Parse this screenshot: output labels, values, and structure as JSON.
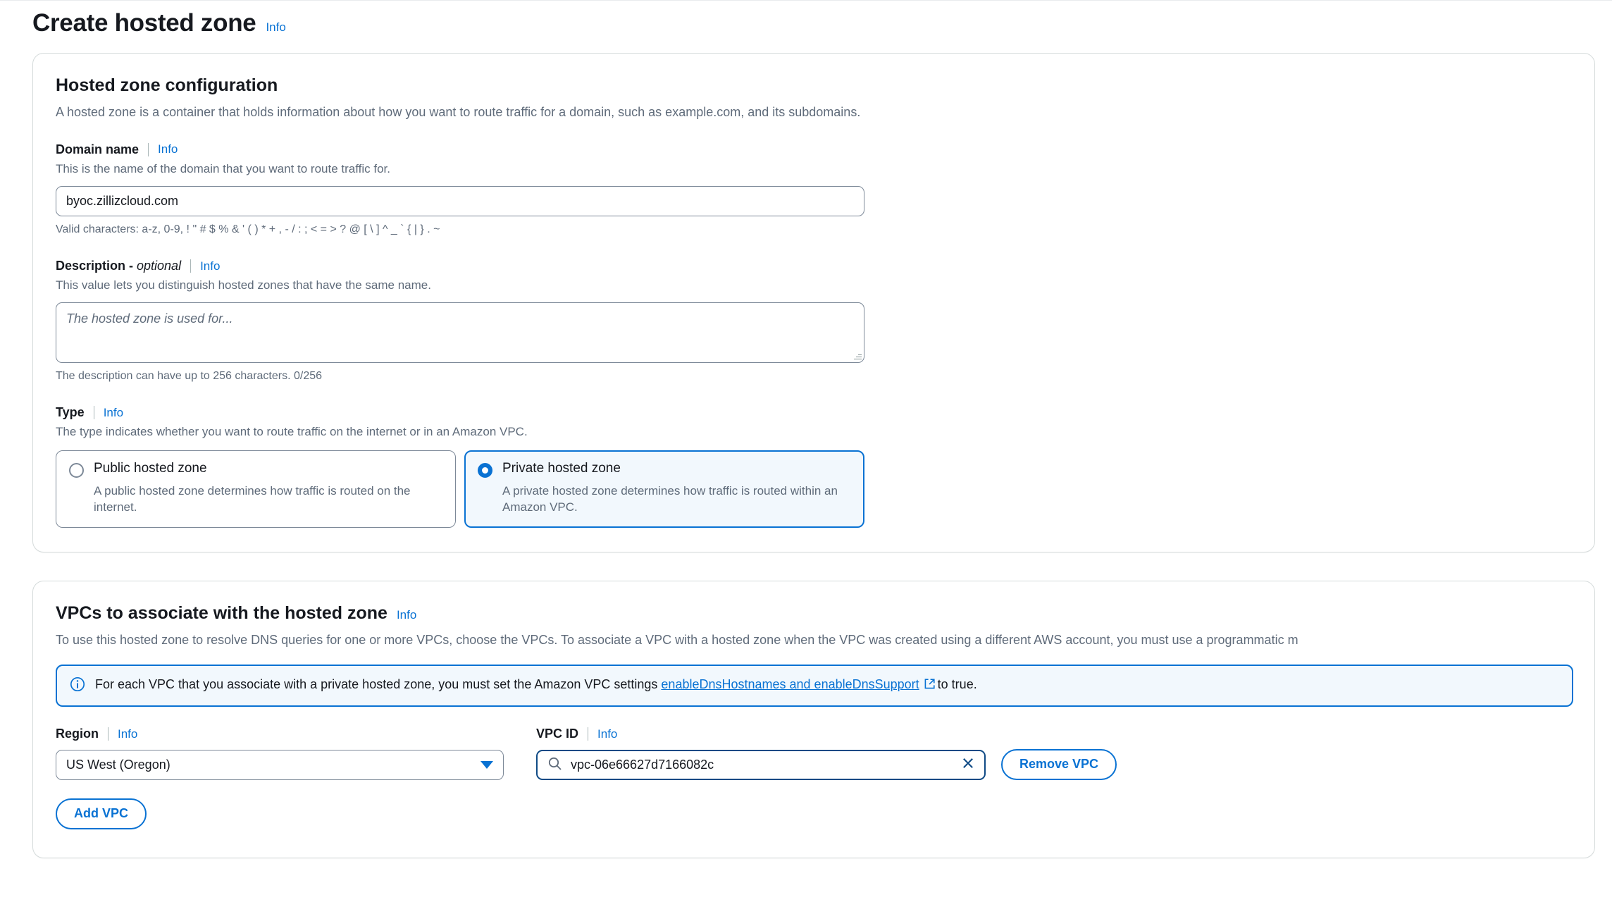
{
  "page": {
    "title": "Create hosted zone",
    "info_label": "Info"
  },
  "hosted_zone_config": {
    "section_title": "Hosted zone configuration",
    "info_label": "Info",
    "section_desc": "A hosted zone is a container that holds information about how you want to route traffic for a domain, such as example.com, and its subdomains.",
    "domain_name": {
      "label": "Domain name",
      "info_label": "Info",
      "desc": "This is the name of the domain that you want to route traffic for.",
      "value": "byoc.zillizcloud.com",
      "hint": "Valid characters: a-z, 0-9, ! \" # $ % & ' ( ) * + , - / : ; < = > ? @ [ \\ ] ^ _ ` { | } . ~"
    },
    "description": {
      "label": "Description - ",
      "label_optional": "optional",
      "info_label": "Info",
      "desc": "This value lets you distinguish hosted zones that have the same name.",
      "placeholder": "The hosted zone is used for...",
      "value": "",
      "hint": "The description can have up to 256 characters. 0/256"
    },
    "type": {
      "label": "Type",
      "info_label": "Info",
      "desc": "The type indicates whether you want to route traffic on the internet or in an Amazon VPC.",
      "options": [
        {
          "title": "Public hosted zone",
          "desc": "A public hosted zone determines how traffic is routed on the internet.",
          "selected": false
        },
        {
          "title": "Private hosted zone",
          "desc": "A private hosted zone determines how traffic is routed within an Amazon VPC.",
          "selected": true
        }
      ]
    }
  },
  "vpc_section": {
    "section_title": "VPCs to associate with the hosted zone",
    "info_label": "Info",
    "section_desc": "To use this hosted zone to resolve DNS queries for one or more VPCs, choose the VPCs. To associate a VPC with a hosted zone when the VPC was created using a different AWS account, you must use a programmatic m",
    "alert": {
      "text_before": "For each VPC that you associate with a private hosted zone, you must set the Amazon VPC settings ",
      "link_text": "enableDnsHostnames and enableDnsSupport",
      "text_after": "to true."
    },
    "region": {
      "label": "Region",
      "info_label": "Info",
      "value": "US West (Oregon)"
    },
    "vpc_id": {
      "label": "VPC ID",
      "info_label": "Info",
      "value": "vpc-06e66627d7166082c"
    },
    "remove_vpc_label": "Remove VPC",
    "add_vpc_label": "Add VPC"
  },
  "colors": {
    "accent_blue": "#0972d3",
    "link_blue": "#0972d3",
    "alert_bg": "#f2f8fd",
    "border_grey": "#7d8998",
    "text_secondary": "#5f6b7a",
    "focus_border": "#0f4a85"
  }
}
